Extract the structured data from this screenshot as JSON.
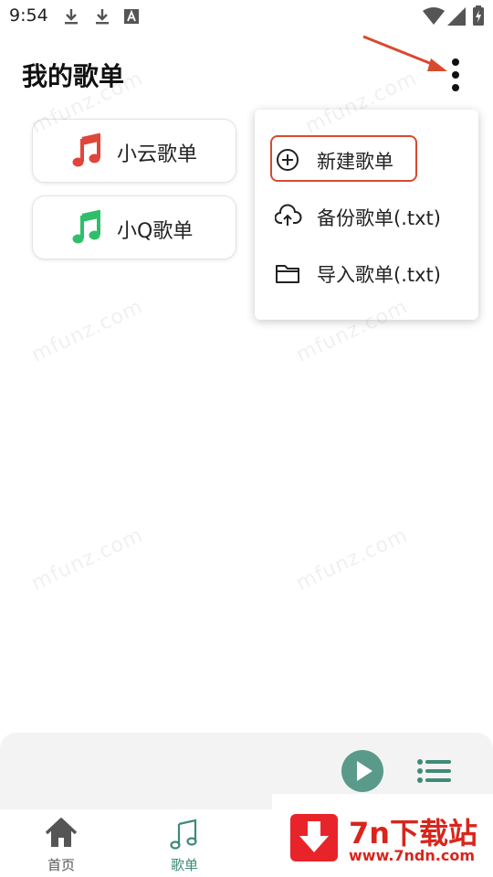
{
  "status_bar": {
    "time": "9:54",
    "icons": [
      "download-icon",
      "download-icon",
      "text-a-icon",
      "wifi-icon",
      "signal-icon",
      "battery-charging-icon"
    ]
  },
  "header": {
    "title": "我的歌单",
    "more_icon": "more-vertical-icon"
  },
  "playlists": [
    {
      "label": "小云歌单",
      "icon": "music-note-icon",
      "icon_color": "#e0453a"
    },
    {
      "label": "小Q歌单",
      "icon": "music-note-icon",
      "icon_color": "#2fbf6a"
    }
  ],
  "menu": {
    "items": [
      {
        "label": "新建歌单",
        "icon": "add-circle-icon"
      },
      {
        "label": "备份歌单(.txt)",
        "icon": "cloud-upload-icon"
      },
      {
        "label": "导入歌单(.txt)",
        "icon": "folder-icon"
      }
    ]
  },
  "watermark_text": "mfunz.com",
  "player": {
    "play_icon": "play-icon",
    "queue_icon": "queue-list-icon",
    "accent": "#5a9a8a"
  },
  "bottom_nav": {
    "items": [
      {
        "label": "首页",
        "icon": "home-icon",
        "color": "#555555"
      },
      {
        "label": "歌单",
        "icon": "music-note-icon",
        "color": "#3f8a78"
      }
    ]
  },
  "site_badge": {
    "title": "7n下载站",
    "url": "www.7ndn.com",
    "color": "#d9251c"
  },
  "colors": {
    "highlight": "#d84a2e",
    "accent": "#3f8a78"
  }
}
